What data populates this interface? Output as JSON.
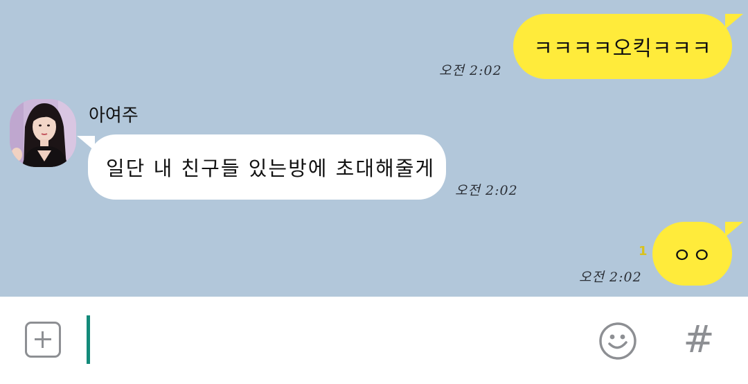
{
  "messages": [
    {
      "direction": "outgoing",
      "text": "ㅋㅋㅋㅋ오킥ㅋㅋㅋ",
      "time": "오전 2:02"
    },
    {
      "direction": "incoming",
      "sender": "아여주",
      "text": "일단 내 친구들 있는방에 초대해줄게",
      "time": "오전 2:02"
    },
    {
      "direction": "outgoing",
      "text": "ㅇㅇ",
      "time": "오전 2:02",
      "unread_count": "1"
    }
  ],
  "input_bar": {
    "plus_icon": "plus-square-icon",
    "emoji_icon": "smiley-icon",
    "hash_label": "#",
    "input_value": ""
  },
  "colors": {
    "chat_background": "#b2c7da",
    "outgoing_bubble": "#ffeb3b",
    "incoming_bubble": "#ffffff",
    "cursor": "#138a7a",
    "icon_gray": "#8d8f93"
  }
}
